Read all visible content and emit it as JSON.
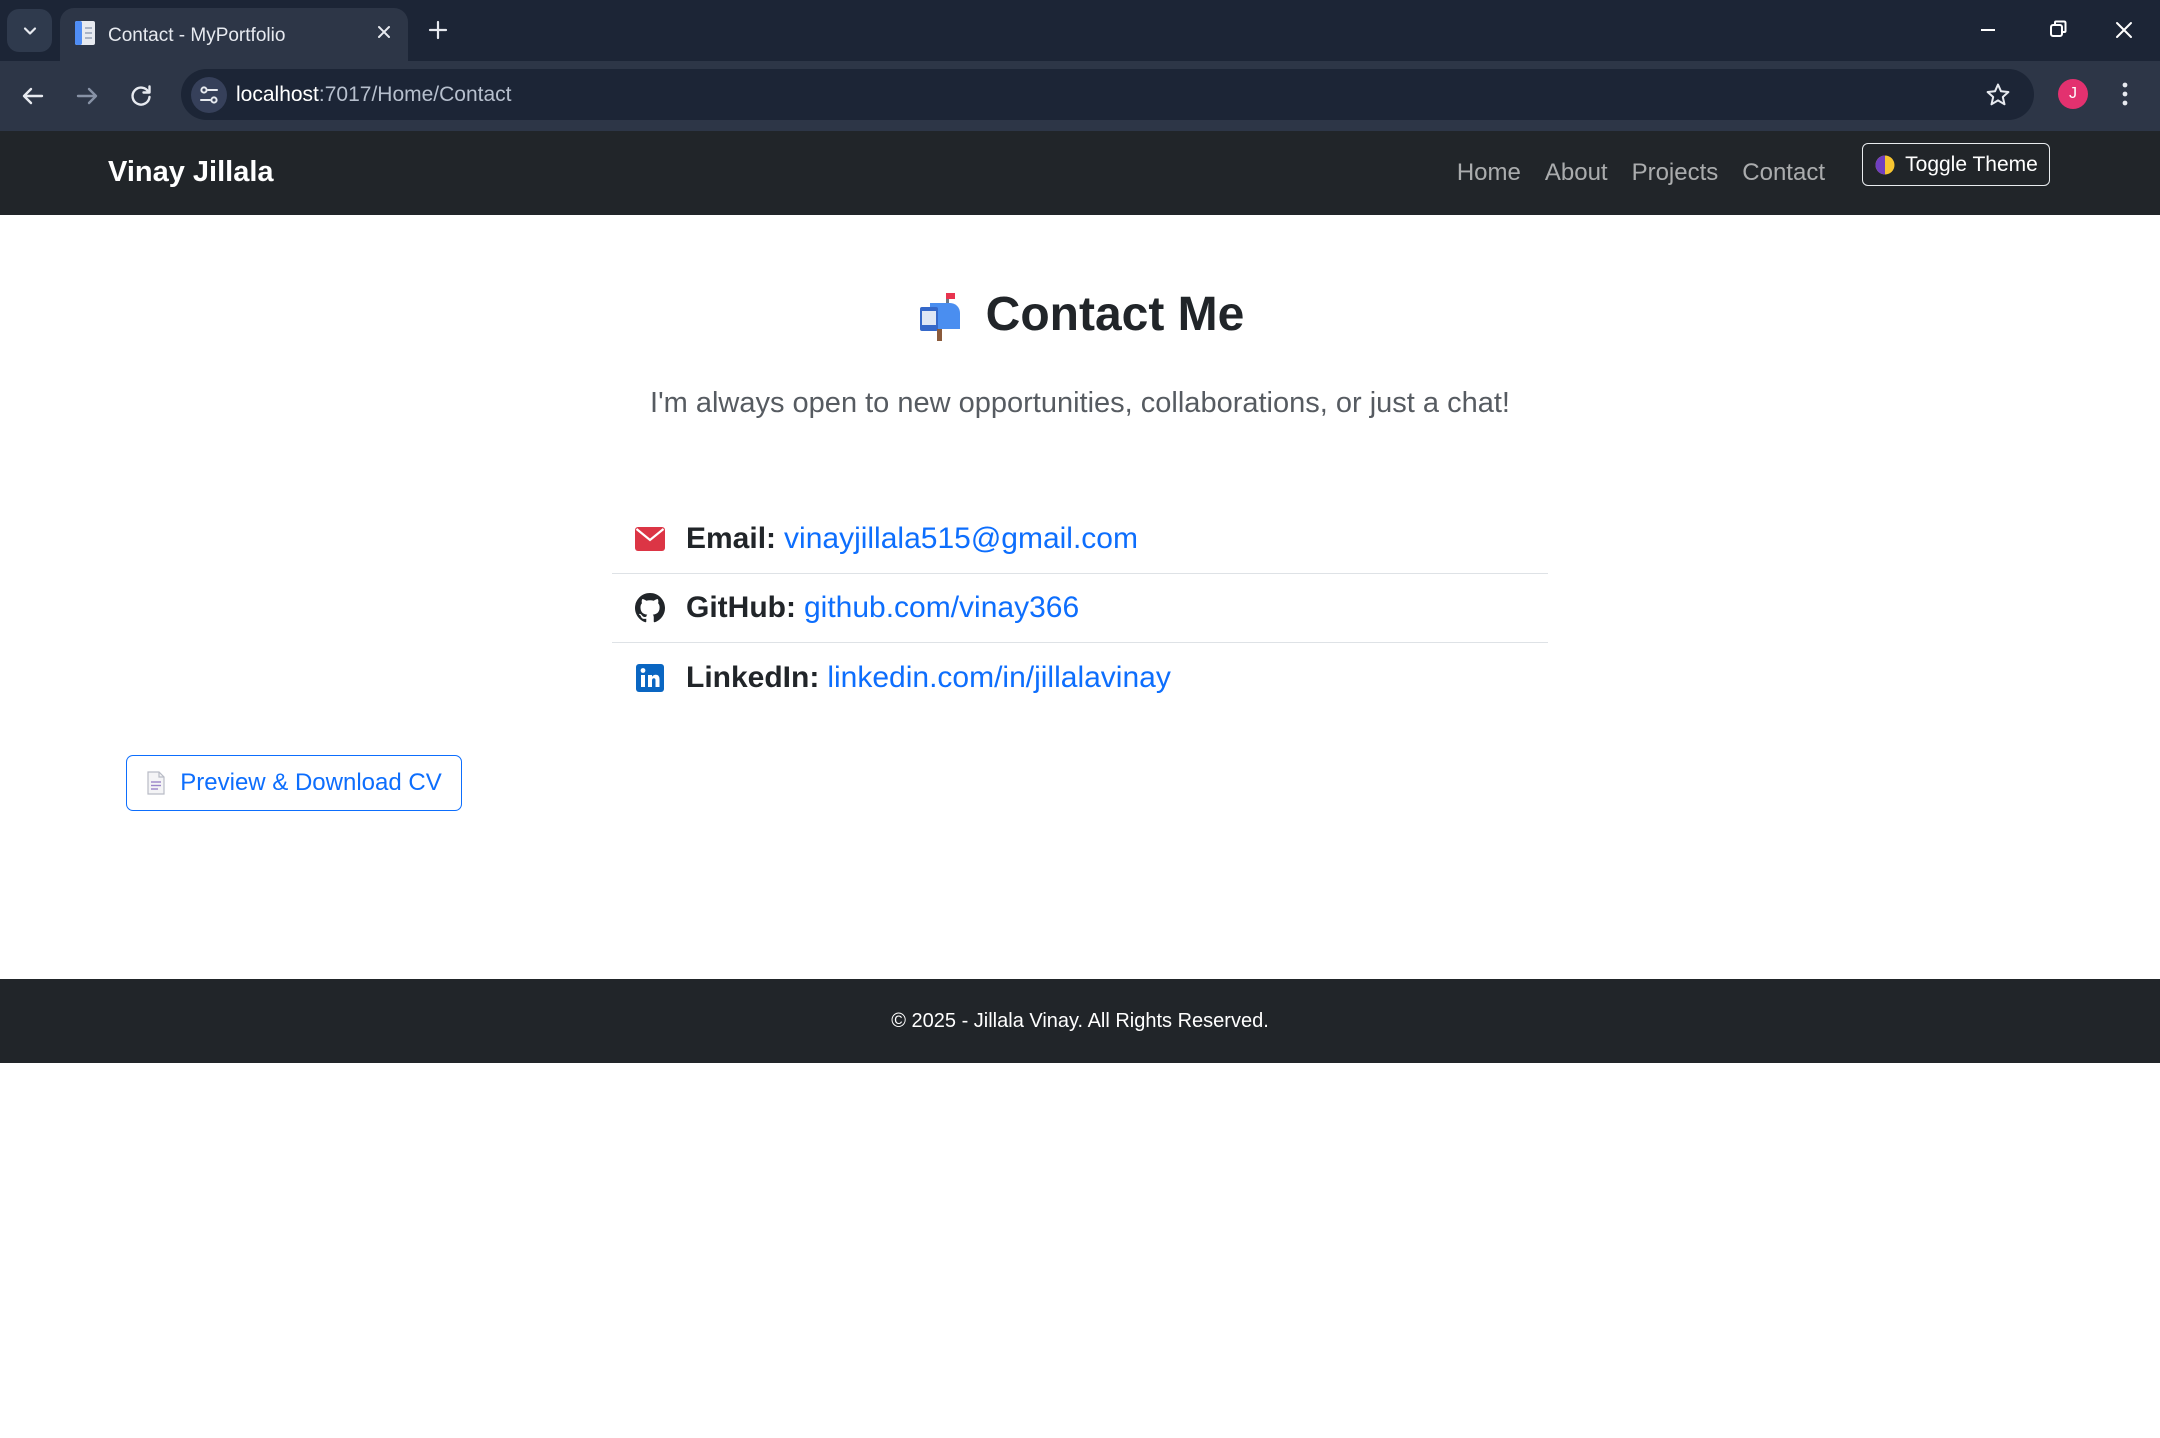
{
  "browser": {
    "tab_title": "Contact - MyPortfolio",
    "url_host": "localhost",
    "url_path": ":7017/Home/Contact",
    "profile_initial": "J"
  },
  "navbar": {
    "brand": "Vinay Jillala",
    "links": [
      "Home",
      "About",
      "Projects",
      "Contact"
    ],
    "toggle_label": "Toggle Theme"
  },
  "contact": {
    "title": "Contact Me",
    "subtitle": "I'm always open to new opportunities, collaborations, or just a chat!",
    "items": [
      {
        "label": "Email:",
        "value": "vinayjillala515@gmail.com",
        "icon": "envelope-icon",
        "color": "#dc3545"
      },
      {
        "label": "GitHub:",
        "value": "github.com/vinay366",
        "icon": "github-icon",
        "color": "#212529"
      },
      {
        "label": "LinkedIn:",
        "value": "linkedin.com/in/jillalavinay",
        "icon": "linkedin-icon",
        "color": "#0a66c2"
      }
    ],
    "cv_button": "Preview & Download CV"
  },
  "footer": {
    "text": "© 2025 - Jillala Vinay. All Rights Reserved."
  },
  "colors": {
    "link": "#0d6efd",
    "navbar_bg": "#212529",
    "chrome_bg": "#1c2536"
  }
}
